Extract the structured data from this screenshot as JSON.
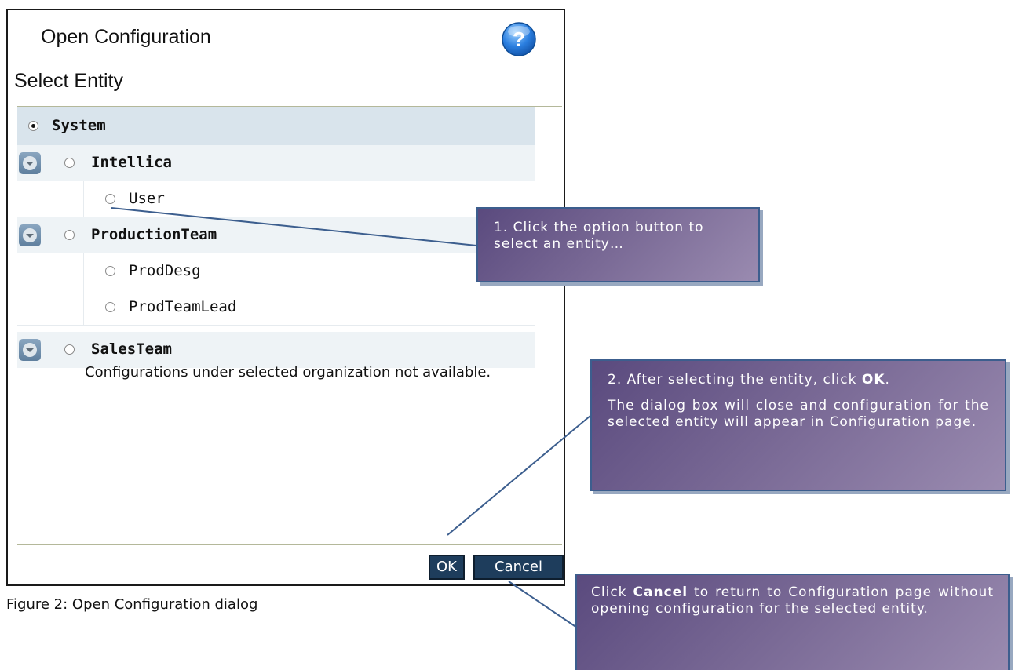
{
  "dialog": {
    "title": "Open Configuration",
    "subtitle": "Select Entity",
    "help_icon": "help-question-icon",
    "tree": [
      {
        "label": "System",
        "selected": true,
        "bold": true,
        "level": 0
      },
      {
        "label": "Intellica",
        "selected": false,
        "bold": true,
        "level": 1,
        "expander": "collapse-chevron-icon"
      },
      {
        "label": "User",
        "selected": false,
        "bold": false,
        "level": 2
      },
      {
        "label": "ProductionTeam",
        "selected": false,
        "bold": true,
        "level": 1,
        "expander": "collapse-chevron-icon"
      },
      {
        "label": "ProdDesg",
        "selected": false,
        "bold": false,
        "level": 2
      },
      {
        "label": "ProdTeamLead",
        "selected": false,
        "bold": false,
        "level": 2
      },
      {
        "label": "SalesTeam",
        "selected": false,
        "bold": true,
        "level": 1,
        "expander": "collapse-chevron-icon"
      }
    ],
    "empty_message": "Configurations under selected organization not available.",
    "ok_label": "OK",
    "cancel_label": "Cancel"
  },
  "caption": "Figure 2: Open Configuration dialog",
  "callouts": {
    "c1": "1. Click the option button to select an entity…",
    "c2_prefix": "2. After selecting the entity, click ",
    "c2_bold": "OK",
    "c2_suffix": ".",
    "c2_body": "The dialog box will close and configuration for the selected entity will appear in Configuration page.",
    "c3_prefix": "Click ",
    "c3_bold": "Cancel",
    "c3_suffix": " to return to Configuration page without opening configuration for the selected entity."
  },
  "colors": {
    "accent_button": "#1e3d5c",
    "selected_row": "#d9e4ec",
    "callout": "#6b5b8c",
    "leader_line": "#3c5e8e"
  }
}
